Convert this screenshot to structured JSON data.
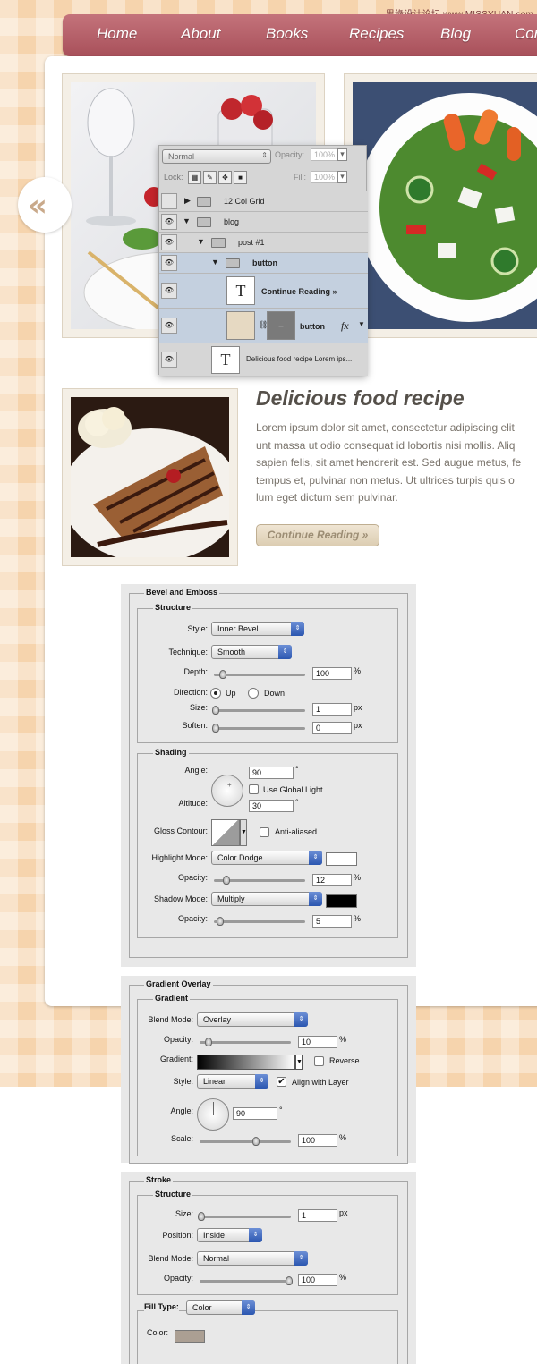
{
  "watermark": "思缘设计论坛 www.MISSYUAN.com",
  "nav": {
    "items": [
      "Home",
      "About",
      "Books",
      "Recipes",
      "Blog",
      "Cor"
    ]
  },
  "slider": {
    "prev_glyph": "«"
  },
  "layers": {
    "blend_mode": "Normal",
    "opacity_label": "Opacity:",
    "opacity_value": "100%",
    "lock_label": "Lock:",
    "fill_label": "Fill:",
    "fill_value": "100%",
    "rows": [
      "12 Col Grid",
      "blog",
      "post #1",
      "button",
      "Continue Reading »",
      "button",
      "Delicious food recipe Lorem ips..."
    ],
    "text_thumb": "T",
    "fx": "fx"
  },
  "post": {
    "title": "Delicious food recipe",
    "body_lines": [
      "Lorem ipsum dolor sit amet, consectetur adipiscing elit",
      "unt massa ut odio consequat id lobortis nisi mollis. Aliq",
      "sapien felis, sit amet hendrerit est. Sed augue metus, fe",
      "tempus et, pulvinar non metus. Ut ultrices turpis quis o",
      "lum eget dictum sem pulvinar."
    ],
    "button": "Continue Reading »"
  },
  "bevel": {
    "title": "Bevel and Emboss",
    "structure": "Structure",
    "style_label": "Style:",
    "style_value": "Inner Bevel",
    "technique_label": "Technique:",
    "technique_value": "Smooth",
    "depth_label": "Depth:",
    "depth_value": "100",
    "depth_unit": "%",
    "direction_label": "Direction:",
    "dir_up": "Up",
    "dir_down": "Down",
    "size_label": "Size:",
    "size_value": "1",
    "size_unit": "px",
    "soften_label": "Soften:",
    "soften_value": "0",
    "soften_unit": "px",
    "shading": "Shading",
    "angle_label": "Angle:",
    "angle_value": "90",
    "deg": "°",
    "global_light": "Use Global Light",
    "altitude_label": "Altitude:",
    "altitude_value": "30",
    "gloss_label": "Gloss Contour:",
    "anti_aliased": "Anti-aliased",
    "highlight_label": "Highlight Mode:",
    "highlight_value": "Color Dodge",
    "opacity_label": "Opacity:",
    "hl_opacity": "12",
    "pct": "%",
    "shadow_label": "Shadow Mode:",
    "shadow_value": "Multiply",
    "sh_opacity": "5"
  },
  "gradient": {
    "title": "Gradient Overlay",
    "sub": "Gradient",
    "blend_label": "Blend Mode:",
    "blend_value": "Overlay",
    "opacity_label": "Opacity:",
    "opacity_value": "10",
    "pct": "%",
    "gradient_label": "Gradient:",
    "reverse": "Reverse",
    "style_label": "Style:",
    "style_value": "Linear",
    "align": "Align with Layer",
    "angle_label": "Angle:",
    "angle_value": "90",
    "deg": "°",
    "scale_label": "Scale:",
    "scale_value": "100"
  },
  "stroke": {
    "title": "Stroke",
    "structure": "Structure",
    "size_label": "Size:",
    "size_value": "1",
    "size_unit": "px",
    "position_label": "Position:",
    "position_value": "Inside",
    "blend_label": "Blend Mode:",
    "blend_value": "Normal",
    "opacity_label": "Opacity:",
    "opacity_value": "100",
    "pct": "%",
    "filltype_label": "Fill Type:",
    "filltype_value": "Color",
    "color_label": "Color:"
  },
  "colors": {
    "nav": "#b15d66",
    "bg": "#f6d4ad",
    "button_fill": "#e6d9c2",
    "title": "#55504a",
    "body": "#7a746c",
    "stroke_color": "#ab9f93",
    "highlight_swatch": "#ffffff",
    "shadow_swatch": "#000000"
  }
}
